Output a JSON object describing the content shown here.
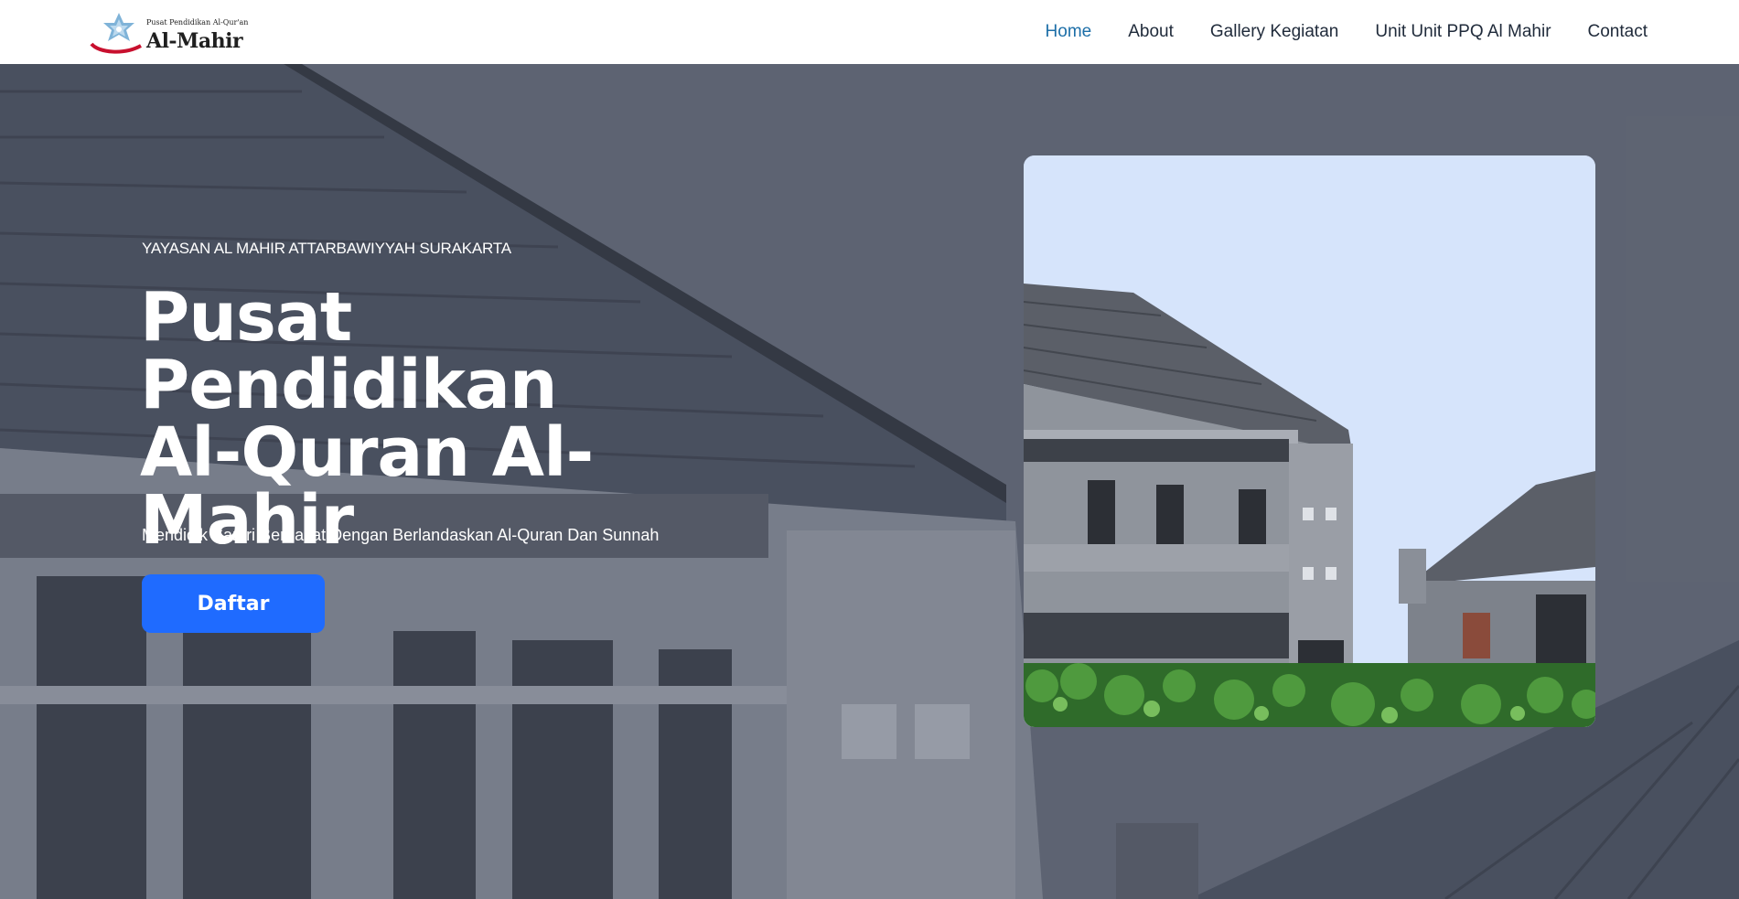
{
  "brand": {
    "tagline": "Pusat Pendidikan Al-Qur'an",
    "name": "Al-Mahir",
    "logo_icon": "star-ornament-icon"
  },
  "nav": {
    "items": [
      {
        "label": "Home",
        "active": true
      },
      {
        "label": "About",
        "active": false
      },
      {
        "label": "Gallery Kegiatan",
        "active": false
      },
      {
        "label": "Unit Unit PPQ Al Mahir",
        "active": false
      },
      {
        "label": "Contact",
        "active": false
      }
    ]
  },
  "hero": {
    "kicker": "YAYASAN AL MAHIR ATTARBAWIYYAH SURAKARTA",
    "title_line1": "Pusat Pendidikan",
    "title_line2": "Al-Quran Al-",
    "title_line3": "Mahir",
    "subtitle": "Mendidik Santri Berbakat Dengan Berlandaskan Al-Quran Dan Sunnah",
    "cta_label": "Daftar"
  },
  "colors": {
    "accent": "#1f6bff",
    "nav_active": "#1d6fa8",
    "background": "#6b7280"
  }
}
